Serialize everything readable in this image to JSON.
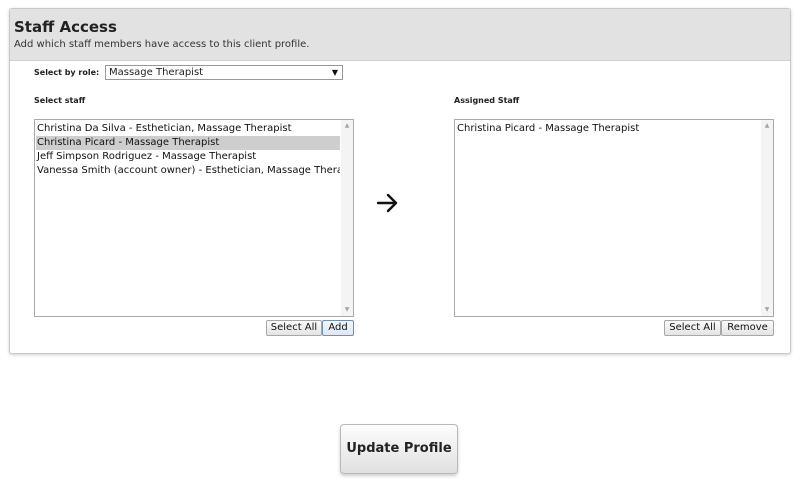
{
  "panel": {
    "title": "Staff Access",
    "subtitle": "Add which staff members have access to this client profile."
  },
  "role_select": {
    "label": "Select by role:",
    "value": "Massage Therapist",
    "arrow_icon": "dropdown-arrow-icon"
  },
  "select_staff": {
    "label": "Select staff",
    "items": [
      {
        "label": "Christina Da Silva - Esthetician, Massage Therapist",
        "selected": false
      },
      {
        "label": "Christina Picard - Massage Therapist",
        "selected": true
      },
      {
        "label": "Jeff Simpson Rodriguez - Massage Therapist",
        "selected": false
      },
      {
        "label": "Vanessa Smith (account owner) - Esthetician, Massage Therapist",
        "selected": false
      }
    ],
    "select_all_label": "Select All",
    "add_label": "Add"
  },
  "transfer_icon": "right-arrow-icon",
  "assigned_staff": {
    "label": "Assigned Staff",
    "items": [
      {
        "label": "Christina Picard - Massage Therapist",
        "selected": false
      }
    ],
    "select_all_label": "Select All",
    "remove_label": "Remove"
  },
  "update_button": {
    "label": "Update Profile"
  },
  "colors": {
    "header_background": "#e2e2e2",
    "selected_row": "#cecece",
    "focused_button_border": "#6e8fb6"
  }
}
